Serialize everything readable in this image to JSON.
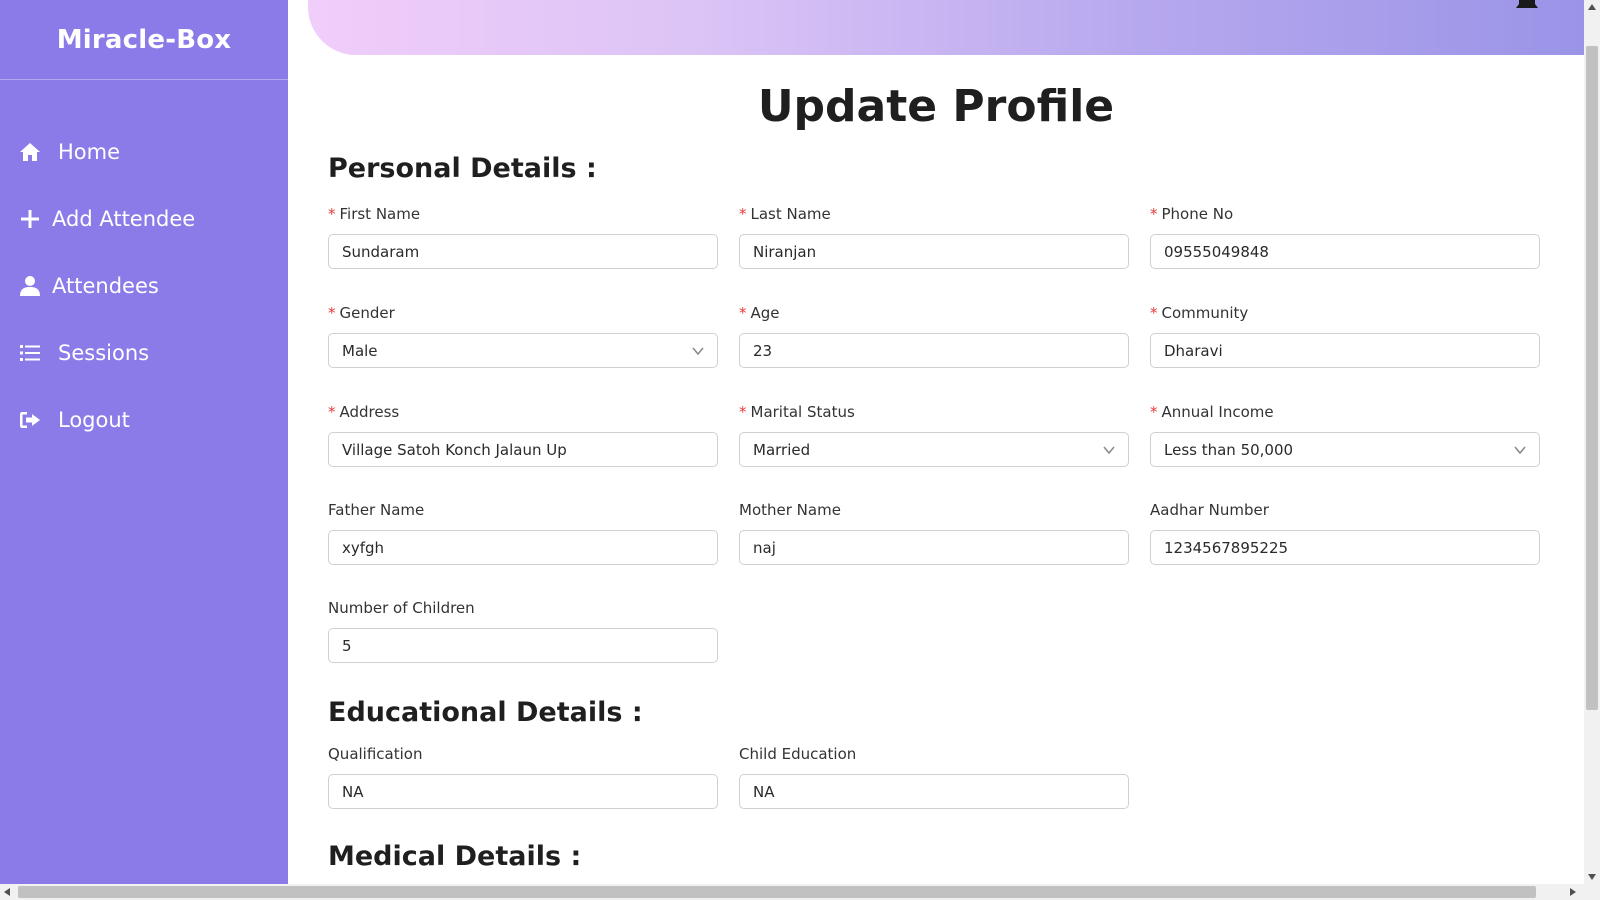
{
  "app": {
    "brand": "Miracle-Box"
  },
  "sidebar": {
    "items": [
      {
        "label": "Home",
        "icon": "home-icon"
      },
      {
        "label": "Add Attendee",
        "icon": "plus-icon"
      },
      {
        "label": "Attendees",
        "icon": "user-icon"
      },
      {
        "label": "Sessions",
        "icon": "list-icon"
      },
      {
        "label": "Logout",
        "icon": "logout-icon"
      }
    ]
  },
  "header": {
    "bell_icon": "bell-icon"
  },
  "page": {
    "title": "Update Profile"
  },
  "sections": {
    "personal": "Personal Details :",
    "educational": "Educational Details :",
    "medical": "Medical Details :"
  },
  "fields": {
    "first_name": {
      "label": "First Name",
      "value": "Sundaram",
      "required": true
    },
    "last_name": {
      "label": "Last Name",
      "value": "Niranjan",
      "required": true
    },
    "phone": {
      "label": "Phone No",
      "value": "09555049848",
      "required": true
    },
    "gender": {
      "label": "Gender",
      "value": "Male",
      "required": true
    },
    "age": {
      "label": "Age",
      "value": "23",
      "required": true
    },
    "community": {
      "label": "Community",
      "value": "Dharavi",
      "required": true
    },
    "address": {
      "label": "Address",
      "value": "Village Satoh Konch Jalaun Up",
      "required": true
    },
    "marital_status": {
      "label": "Marital Status",
      "value": "Married",
      "required": true
    },
    "annual_income": {
      "label": "Annual Income",
      "value": "Less than 50,000",
      "required": true
    },
    "father_name": {
      "label": "Father Name",
      "value": "xyfgh"
    },
    "mother_name": {
      "label": "Mother Name",
      "value": "naj"
    },
    "aadhar": {
      "label": "Aadhar Number",
      "value": "1234567895225"
    },
    "children": {
      "label": "Number of Children",
      "value": "5"
    },
    "qualification": {
      "label": "Qualification",
      "value": "NA"
    },
    "child_education": {
      "label": "Child Education",
      "value": "NA"
    }
  },
  "required_marker": "*",
  "colors": {
    "sidebar": "#8b7be8",
    "required": "#e23c3c",
    "header_start": "#f1cdfa",
    "header_end": "#9a94e7"
  }
}
